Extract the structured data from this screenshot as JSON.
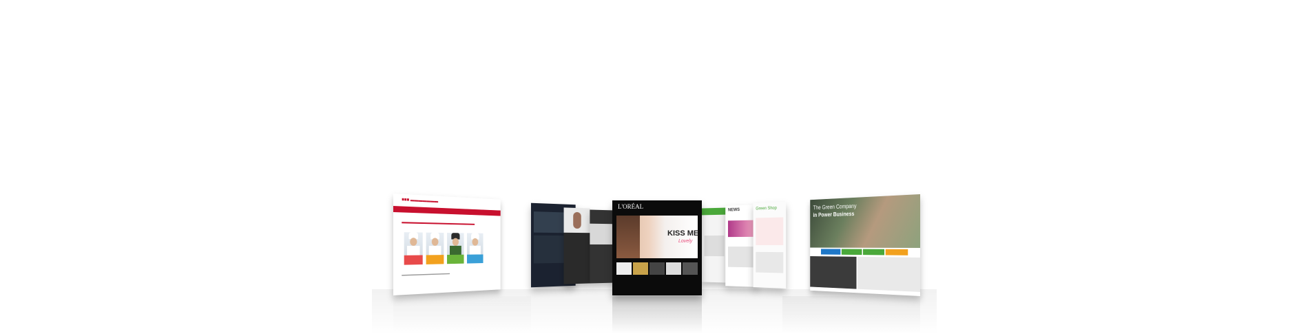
{
  "showcase": {
    "brand_logo": "L'ORÉAL",
    "headline": "KISS ME",
    "headline_script": "Lovely",
    "tagline_left": "The Green Company",
    "tagline_right": "in Power Business",
    "news_label": "NEWS",
    "shop_label": "Green Shop"
  },
  "colors": {
    "red": "#c8102e",
    "blue": "#1f78c8",
    "green": "#4aa83a",
    "orange": "#f2a11e",
    "pink": "#e84a7a",
    "dark": "#0b0b0b"
  }
}
